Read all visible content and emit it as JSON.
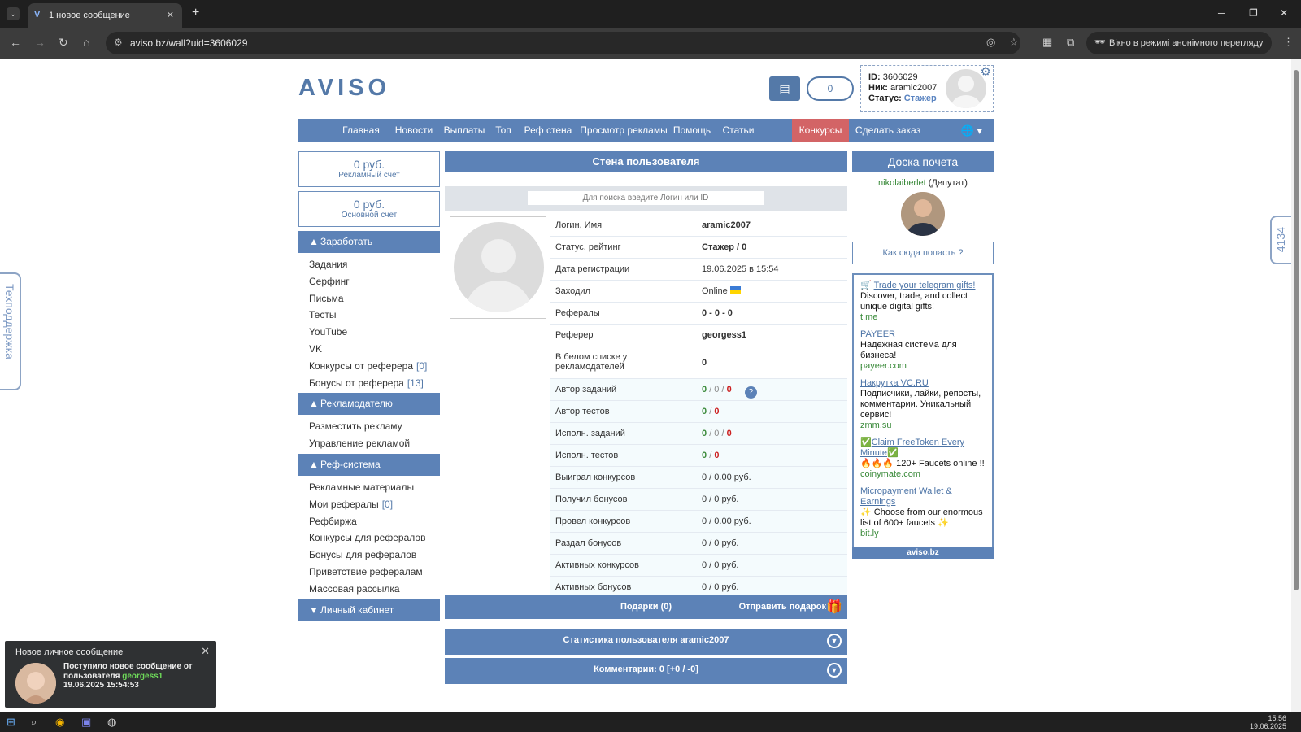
{
  "browser": {
    "tab_title": "1 новое сообщение",
    "url": "aviso.bz/wall?uid=3606029",
    "incognito_label": "Вікно в режимі анонімного перегляду"
  },
  "header": {
    "logo": "AVISO",
    "balance_pill": "0",
    "user": {
      "id_label": "ID:",
      "id": "3606029",
      "nick_label": "Ник:",
      "nick": "aramic2007",
      "status_label": "Статус:",
      "status": "Стажер"
    }
  },
  "nav": {
    "items": [
      "Главная",
      "Новости",
      "Выплаты",
      "Топ",
      "Реф стена",
      "Просмотр рекламы",
      "Помощь",
      "Статьи",
      "Конкурсы",
      "Сделать заказ"
    ],
    "active": "Конкурсы"
  },
  "left": {
    "ad_account": {
      "amount": "0 руб.",
      "label": "Рекламный счет"
    },
    "main_account": {
      "amount": "0 руб.",
      "label": "Основной счет"
    },
    "sections": [
      {
        "title": "Заработать",
        "items": [
          {
            "label": "Задания",
            "count": ""
          },
          {
            "label": "Серфинг",
            "count": ""
          },
          {
            "label": "Письма",
            "count": ""
          },
          {
            "label": "Тесты",
            "count": ""
          },
          {
            "label": "YouTube",
            "count": ""
          },
          {
            "label": "VK",
            "count": ""
          },
          {
            "label": "Конкурсы от реферера",
            "count": "[0]"
          },
          {
            "label": "Бонусы от реферера",
            "count": "[13]"
          }
        ]
      },
      {
        "title": "Рекламодателю",
        "items": [
          {
            "label": "Разместить рекламу",
            "count": ""
          },
          {
            "label": "Управление рекламой",
            "count": ""
          }
        ]
      },
      {
        "title": "Реф-система",
        "items": [
          {
            "label": "Рекламные материалы",
            "count": ""
          },
          {
            "label": "Мои рефералы",
            "count": "[0]"
          },
          {
            "label": "Рефбиржа",
            "count": ""
          },
          {
            "label": "Конкурсы для рефералов",
            "count": ""
          },
          {
            "label": "Бонусы для рефералов",
            "count": ""
          },
          {
            "label": "Приветствие рефералам",
            "count": ""
          },
          {
            "label": "Массовая рассылка",
            "count": ""
          }
        ]
      },
      {
        "title": "Личный кабинет",
        "items": []
      }
    ]
  },
  "center": {
    "title": "Стена пользователя",
    "search_placeholder": "Для поиска введите Логин или ID",
    "profile_rows": [
      {
        "key": "Логин, Имя",
        "value": "aramic2007"
      },
      {
        "key": "Статус, рейтинг",
        "value": "Стажер / 0"
      },
      {
        "key": "Дата регистрации",
        "value": "19.06.2025 в 15:54"
      },
      {
        "key": "Заходил",
        "value": "Online"
      },
      {
        "key": "Рефералы",
        "value": "0 - 0 - 0"
      },
      {
        "key": "Реферер",
        "value": "georgess1"
      },
      {
        "key": "В белом списке у рекламодателей",
        "value": "0"
      },
      {
        "key": "Автор заданий",
        "value": "0 / 0 / 0"
      },
      {
        "key": "Автор тестов",
        "value": "0 / 0"
      },
      {
        "key": "Исполн. заданий",
        "value": "0 / 0 / 0"
      },
      {
        "key": "Исполн. тестов",
        "value": "0 / 0"
      },
      {
        "key": "Выиграл конкурсов",
        "value": "0 / 0.00 руб."
      },
      {
        "key": "Получил бонусов",
        "value": "0 / 0 руб."
      },
      {
        "key": "Провел конкурсов",
        "value": "0 / 0.00 руб."
      },
      {
        "key": "Раздал бонусов",
        "value": "0 / 0 руб."
      },
      {
        "key": "Активных конкурсов",
        "value": "0 / 0 руб."
      },
      {
        "key": "Активных бонусов",
        "value": "0 / 0 руб."
      }
    ],
    "gifts_label": "Подарки (0)",
    "send_gift_label": "Отправить подарок",
    "stats_label": "Статистика пользователя aramic2007",
    "comments_label": "Комментарии: 0 [+0 / -0]"
  },
  "right": {
    "honor_title": "Доска почета",
    "honor_user": "nikolaiberlet",
    "honor_role": "(Депутат)",
    "howto_label": "Как сюда попасть ?",
    "ads": [
      {
        "title": "Trade your telegram gifts!",
        "desc": "Discover, trade, and collect unique digital gifts!",
        "domain": "t.me"
      },
      {
        "title": "PAYEER",
        "desc": "Надежная система для бизнеса!",
        "domain": "payeer.com"
      },
      {
        "title": "Накрутка VC.RU",
        "desc": "Подписчики, лайки, репосты, комментарии. Уникальный сервис!",
        "domain": "zmm.su"
      },
      {
        "title": "Claim FreeToken Every Minute",
        "desc": "120+ Faucets online !!",
        "domain": "coinymate.com"
      },
      {
        "title": "Micropayment Wallet & Earnings",
        "desc": "Choose from our enormous list of 600+ faucets",
        "domain": "bit.ly"
      }
    ],
    "ads_footer": "aviso.bz"
  },
  "side": {
    "support_label": "Техподдержка",
    "counter": "4134"
  },
  "toast": {
    "title": "Новое личное сообщение",
    "line1": "Поступило новое сообщение от",
    "line2_prefix": "пользователя",
    "user": "georgess1",
    "time": "19.06.2025 15:54:53"
  },
  "taskbar": {
    "time": "15:56",
    "date": "19.06.2025"
  },
  "colors": {
    "brand_blue": "#5c82b7",
    "active_red": "#d36466",
    "green": "#3a8a3a",
    "red": "#cc2020"
  }
}
